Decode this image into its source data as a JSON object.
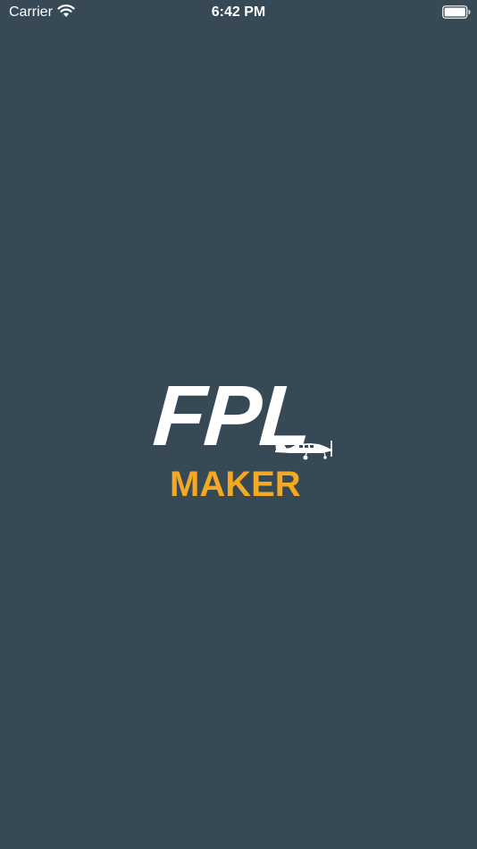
{
  "status_bar": {
    "carrier": "Carrier",
    "time": "6:42 PM",
    "icons": [
      "wifi-icon",
      "battery-icon"
    ]
  },
  "splash": {
    "logo_primary": "FPL",
    "logo_secondary": "MAKER",
    "colors": {
      "background": "#364955",
      "primary_text": "#ffffff",
      "accent": "#f4a823"
    },
    "icons": [
      "airplane-icon"
    ]
  }
}
